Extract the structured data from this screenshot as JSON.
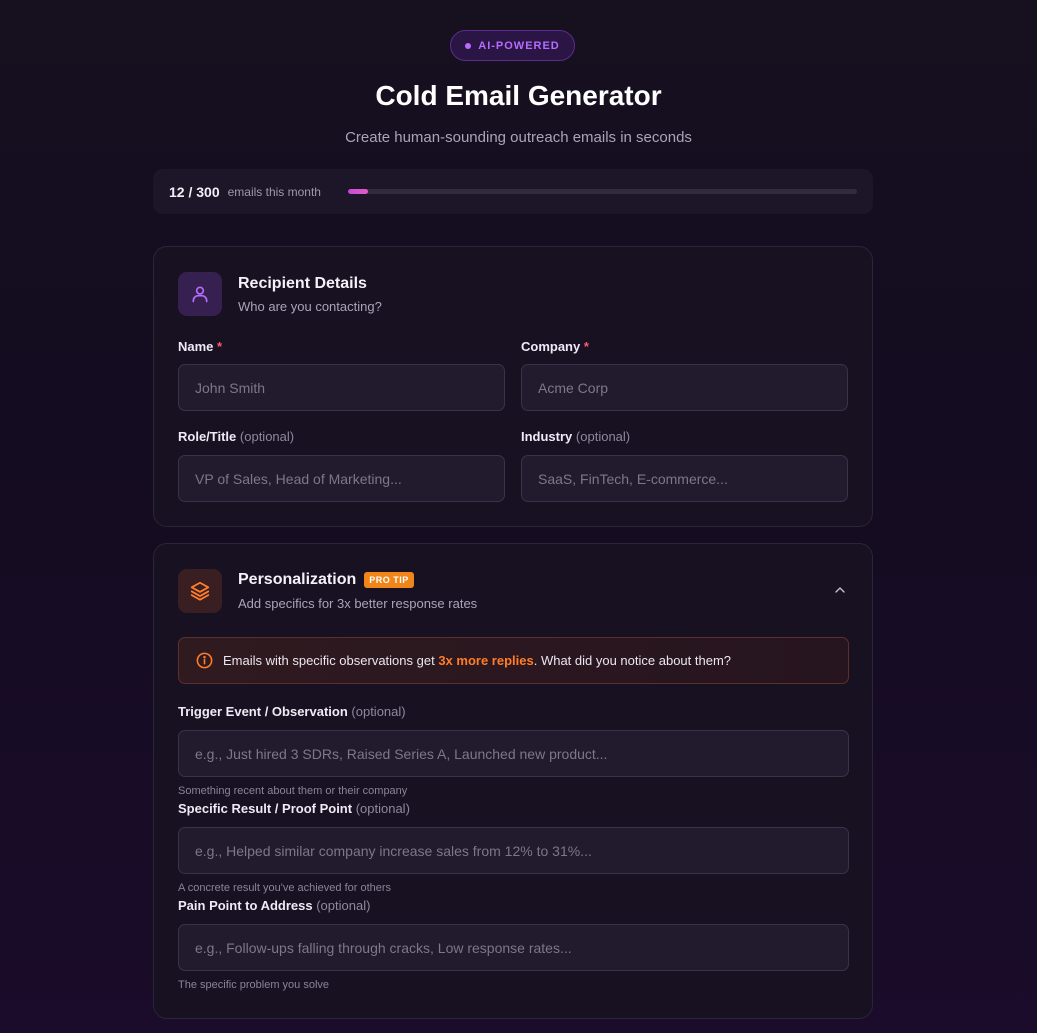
{
  "header": {
    "badge": "AI-POWERED",
    "title": "Cold Email Generator",
    "subtitle": "Create human-sounding outreach emails in seconds"
  },
  "usage": {
    "count": "12 / 300",
    "label": "emails this month",
    "progress_fraction": 0.04
  },
  "recipient": {
    "title": "Recipient Details",
    "subtitle": "Who are you contacting?",
    "name_label": "Name",
    "name_required": "*",
    "name_placeholder": "John Smith",
    "company_label": "Company",
    "company_required": "*",
    "company_placeholder": "Acme Corp",
    "role_label": "Role/Title",
    "role_optional": "(optional)",
    "role_placeholder": "VP of Sales, Head of Marketing...",
    "industry_label": "Industry",
    "industry_optional": "(optional)",
    "industry_placeholder": "SaaS, FinTech, E-commerce..."
  },
  "personalization": {
    "title": "Personalization",
    "badge": "PRO TIP",
    "subtitle": "Add specifics for 3x better response rates",
    "tip_before": "Emails with specific observations get",
    "tip_highlight": "3x more replies",
    "tip_after": ". What did you notice about them?",
    "trigger_label": "Trigger Event / Observation",
    "trigger_optional": "(optional)",
    "trigger_placeholder": "e.g., Just hired 3 SDRs, Raised Series A, Launched new product...",
    "trigger_hint": "Something recent about them or their company",
    "result_label": "Specific Result / Proof Point",
    "result_optional": "(optional)",
    "result_placeholder": "e.g., Helped similar company increase sales from 12% to 31%...",
    "result_hint": "A concrete result you've achieved for others",
    "pain_label": "Pain Point to Address",
    "pain_optional": "(optional)",
    "pain_placeholder": "e.g., Follow-ups falling through cracks, Low response rates...",
    "pain_hint": "The specific problem you solve"
  },
  "colors": {
    "accent_purple": "#b56cff",
    "accent_orange": "#f0851a",
    "required_red": "#ff5a6e",
    "progress": "#d050d0"
  },
  "icons": {
    "recipient": "user-icon",
    "personalization": "layers-icon",
    "collapse": "chevron-up-icon",
    "tip": "info-icon"
  }
}
